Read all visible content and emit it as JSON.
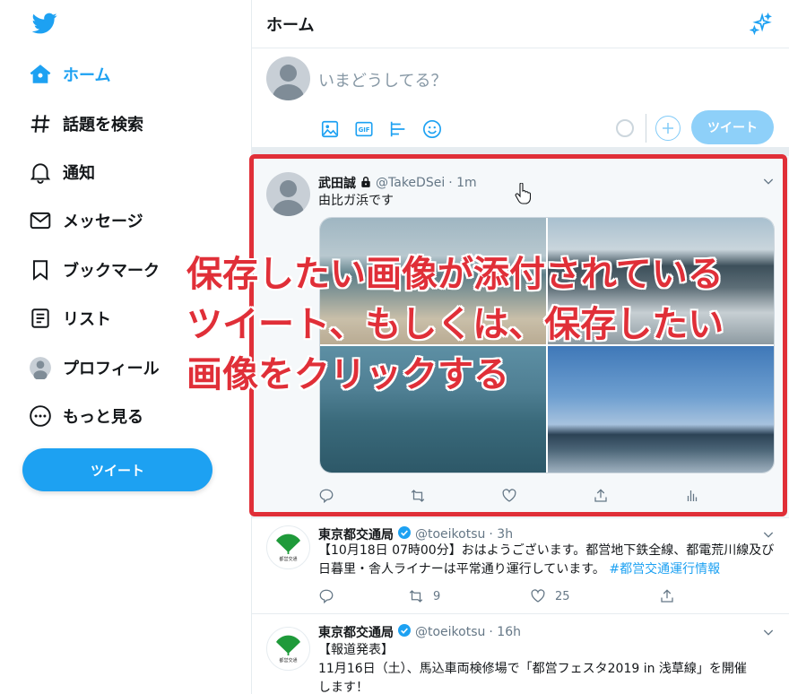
{
  "sidebar": {
    "items": [
      {
        "label": "ホーム",
        "icon": "home-icon",
        "active": true
      },
      {
        "label": "話題を検索",
        "icon": "hashtag-icon"
      },
      {
        "label": "通知",
        "icon": "bell-icon"
      },
      {
        "label": "メッセージ",
        "icon": "mail-icon"
      },
      {
        "label": "ブックマーク",
        "icon": "bookmark-icon"
      },
      {
        "label": "リスト",
        "icon": "list-icon"
      },
      {
        "label": "プロフィール",
        "icon": "avatar-icon"
      },
      {
        "label": "もっと見る",
        "icon": "more-icon"
      }
    ],
    "tweet_button": "ツイート"
  },
  "header": {
    "title": "ホーム"
  },
  "composer": {
    "placeholder": "いまどうしてる？",
    "tweet_button": "ツイート"
  },
  "tweets": [
    {
      "name": "武田誠",
      "handle": "@TakeDSei",
      "time": "· 1m",
      "text": "由比ガ浜です",
      "photos": 4
    },
    {
      "name": "東京都交通局",
      "handle": "@toeikotsu",
      "time": "· 3h",
      "text": "【10月18日 07時00分】おはようございます。都営地下鉄全線、都電荒川線及び日暮里・舎人ライナーは平常通り運行しています。",
      "hashtag": "#都営交通運行情報",
      "retweets": "9",
      "likes": "25",
      "logo_text": "都営交通"
    },
    {
      "name": "東京都交通局",
      "handle": "@toeikotsu",
      "time": "· 16h",
      "text_line1": "【報道発表】",
      "text_line2": "11月16日（土）、馬込車両検修場で「都営フェスタ2019 in 浅草線」を開催",
      "text_line3": "します！",
      "logo_text": "都営交通"
    }
  ],
  "annotation": {
    "line1": "保存したい画像が添付されている",
    "line2": "ツイート、もしくは、保存したい",
    "line3": "画像をクリックする"
  },
  "colors": {
    "accent": "#1da1f2",
    "highlight": "#e02f38",
    "toei_green": "#1f9a3a"
  }
}
